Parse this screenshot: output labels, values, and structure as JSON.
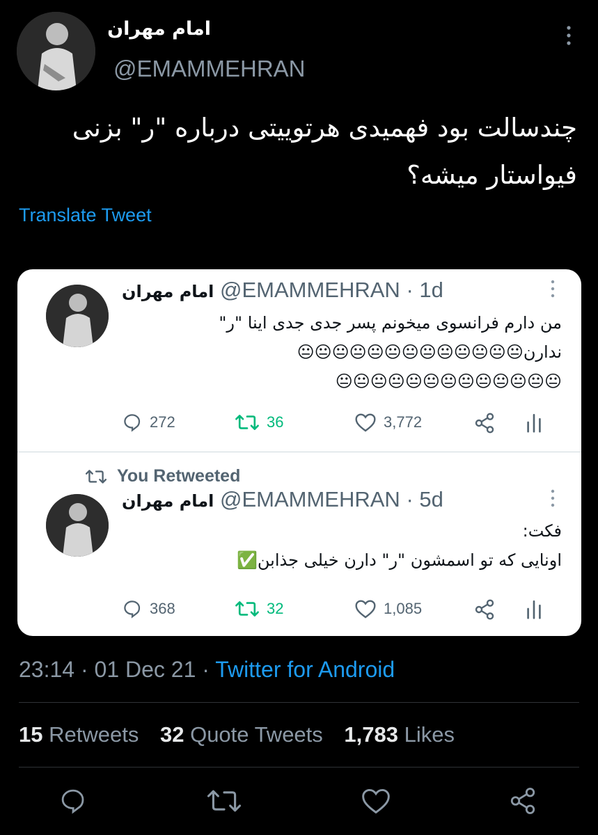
{
  "tweet": {
    "author_name": "امام مهران",
    "author_handle": "@EMAMMEHRAN",
    "text": "چندسالت بود فهمیدی هرتوییتی درباره \"ر\" بزنی فیواستار میشه؟",
    "translate_label": "Translate Tweet",
    "time": "23:14",
    "date": "01 Dec 21",
    "source": "Twitter for Android",
    "separator": "·"
  },
  "quoted": [
    {
      "author_name": "امام مهران",
      "author_handle": "@EMAMMEHRAN",
      "age": "1d",
      "text_line1": "من دارم فرانسوی میخونم پسر جدی جدی اینا \"ر\"",
      "text_line2": "ندارن😐😐😐😐😐😐😐😐😐😐😐😐😐",
      "text_line3": "😐😐😐😐😐😐😐😐😐😐😐😐😐",
      "replies": "272",
      "retweets": "36",
      "likes": "3,772"
    },
    {
      "retweet_notice": "You Retweeted",
      "author_name": "امام مهران",
      "author_handle": "@EMAMMEHRAN",
      "age": "5d",
      "text_line1": "فکت:",
      "text_line2": "اونایی که تو اسمشون \"ر\" دارن خیلی جذابن✅",
      "replies": "368",
      "retweets": "32",
      "likes": "1,085"
    }
  ],
  "stats": {
    "retweets_count": "15",
    "retweets_label": "Retweets",
    "quotes_count": "32",
    "quotes_label": "Quote Tweets",
    "likes_count": "1,783",
    "likes_label": "Likes"
  },
  "icons": {
    "more": "more-vertical-icon",
    "reply": "reply-icon",
    "retweet": "retweet-icon",
    "like": "heart-icon",
    "share": "share-icon",
    "analytics": "analytics-icon"
  },
  "colors": {
    "background": "#000000",
    "link": "#1d9bf0",
    "retweet_green": "#00ba7c",
    "muted": "#8b98a5"
  }
}
